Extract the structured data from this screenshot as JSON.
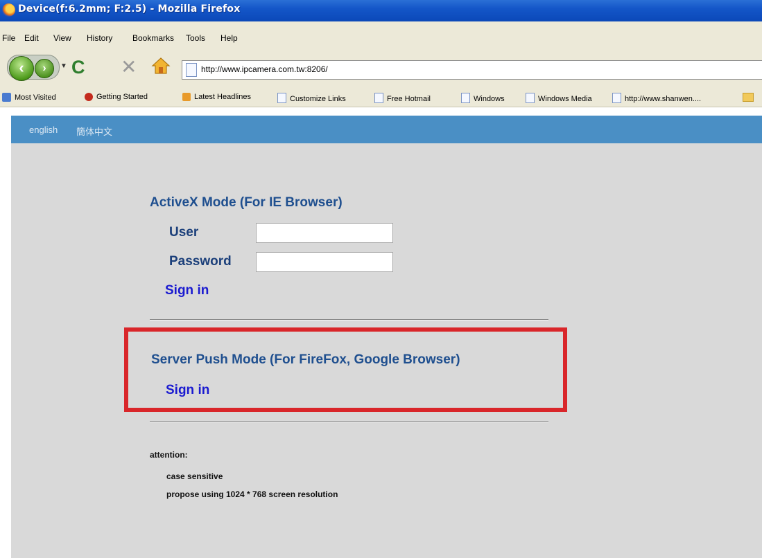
{
  "window": {
    "title": "Device(f:6.2mm; F:2.5) - Mozilla Firefox"
  },
  "menu": {
    "items": [
      "File",
      "Edit",
      "View",
      "History",
      "Bookmarks",
      "Tools",
      "Help"
    ]
  },
  "nav": {
    "url": "http://www.ipcamera.com.tw:8206/"
  },
  "bookmarks": {
    "items": [
      "Most Visited",
      "Getting Started",
      "Latest Headlines",
      "Customize Links",
      "Free Hotmail",
      "Windows",
      "Windows Media",
      "http://www.shanwen...."
    ]
  },
  "header": {
    "languages": [
      "english",
      "簡体中文"
    ]
  },
  "activex": {
    "title": "ActiveX Mode (For IE Browser)",
    "user_label": "User",
    "password_label": "Password",
    "user_value": "",
    "password_value": "",
    "signin_label": "Sign in"
  },
  "serverpush": {
    "title": "Server Push Mode (For FireFox, Google Browser)",
    "signin_label": "Sign in",
    "highlight_color": "#d9262a"
  },
  "attention": {
    "heading": "attention:",
    "lines": [
      "case sensitive",
      "propose using 1024 * 768 screen resolution"
    ]
  },
  "colors": {
    "header_band": "#4a8fc5",
    "panel_bg": "#d9d9d9",
    "title_blue": "#1f4f8f",
    "link_blue": "#1a1ad0"
  }
}
